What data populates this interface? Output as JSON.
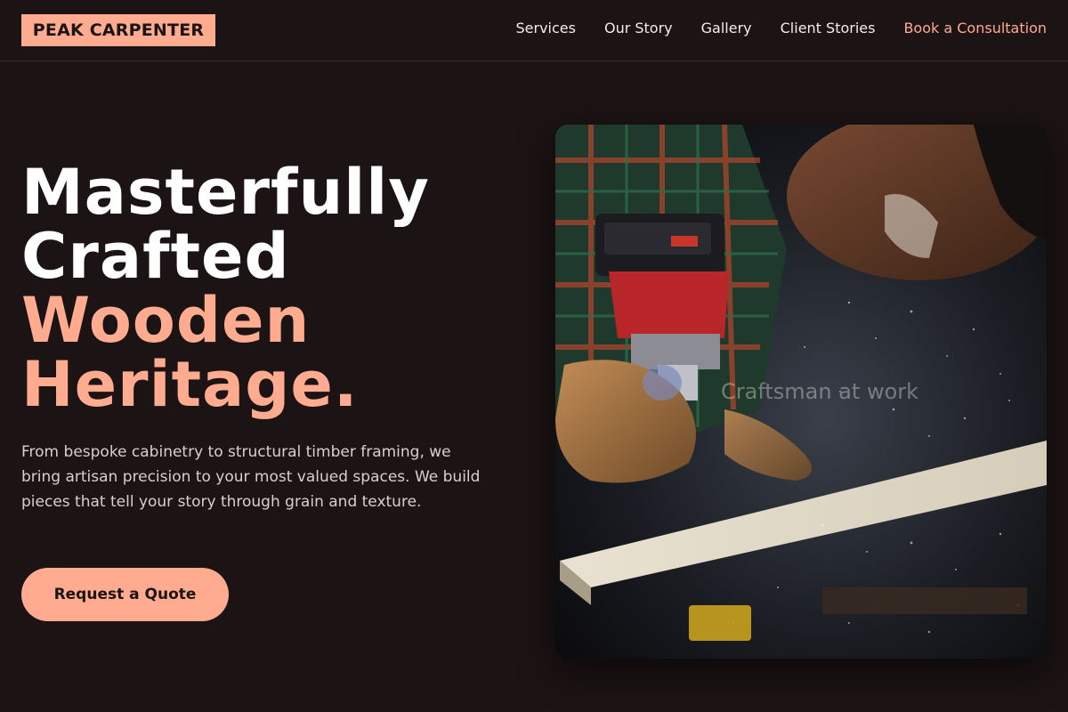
{
  "header": {
    "logo_text": "PEAK CARPENTER",
    "nav": [
      {
        "label": "Services"
      },
      {
        "label": "Our Story"
      },
      {
        "label": "Gallery"
      },
      {
        "label": "Client Stories"
      },
      {
        "label": "Book a Consultation"
      }
    ]
  },
  "hero": {
    "title_lines": [
      "Masterfully",
      "Crafted",
      "Wooden",
      "Heritage."
    ],
    "description": "From bespoke cabinetry to structural timber framing, we bring artisan precision to your most valued spaces. We build pieces that tell your story through grain and texture.",
    "cta_label": "Request a Quote",
    "image_caption": "Craftsman at work"
  },
  "colors": {
    "background": "#1b1314",
    "accent": "#ffab8f",
    "text": "#ffffff",
    "muted_text": "#d8d0cf"
  },
  "icons": {
    "photo": "carpenter-routing-wood-photo"
  }
}
